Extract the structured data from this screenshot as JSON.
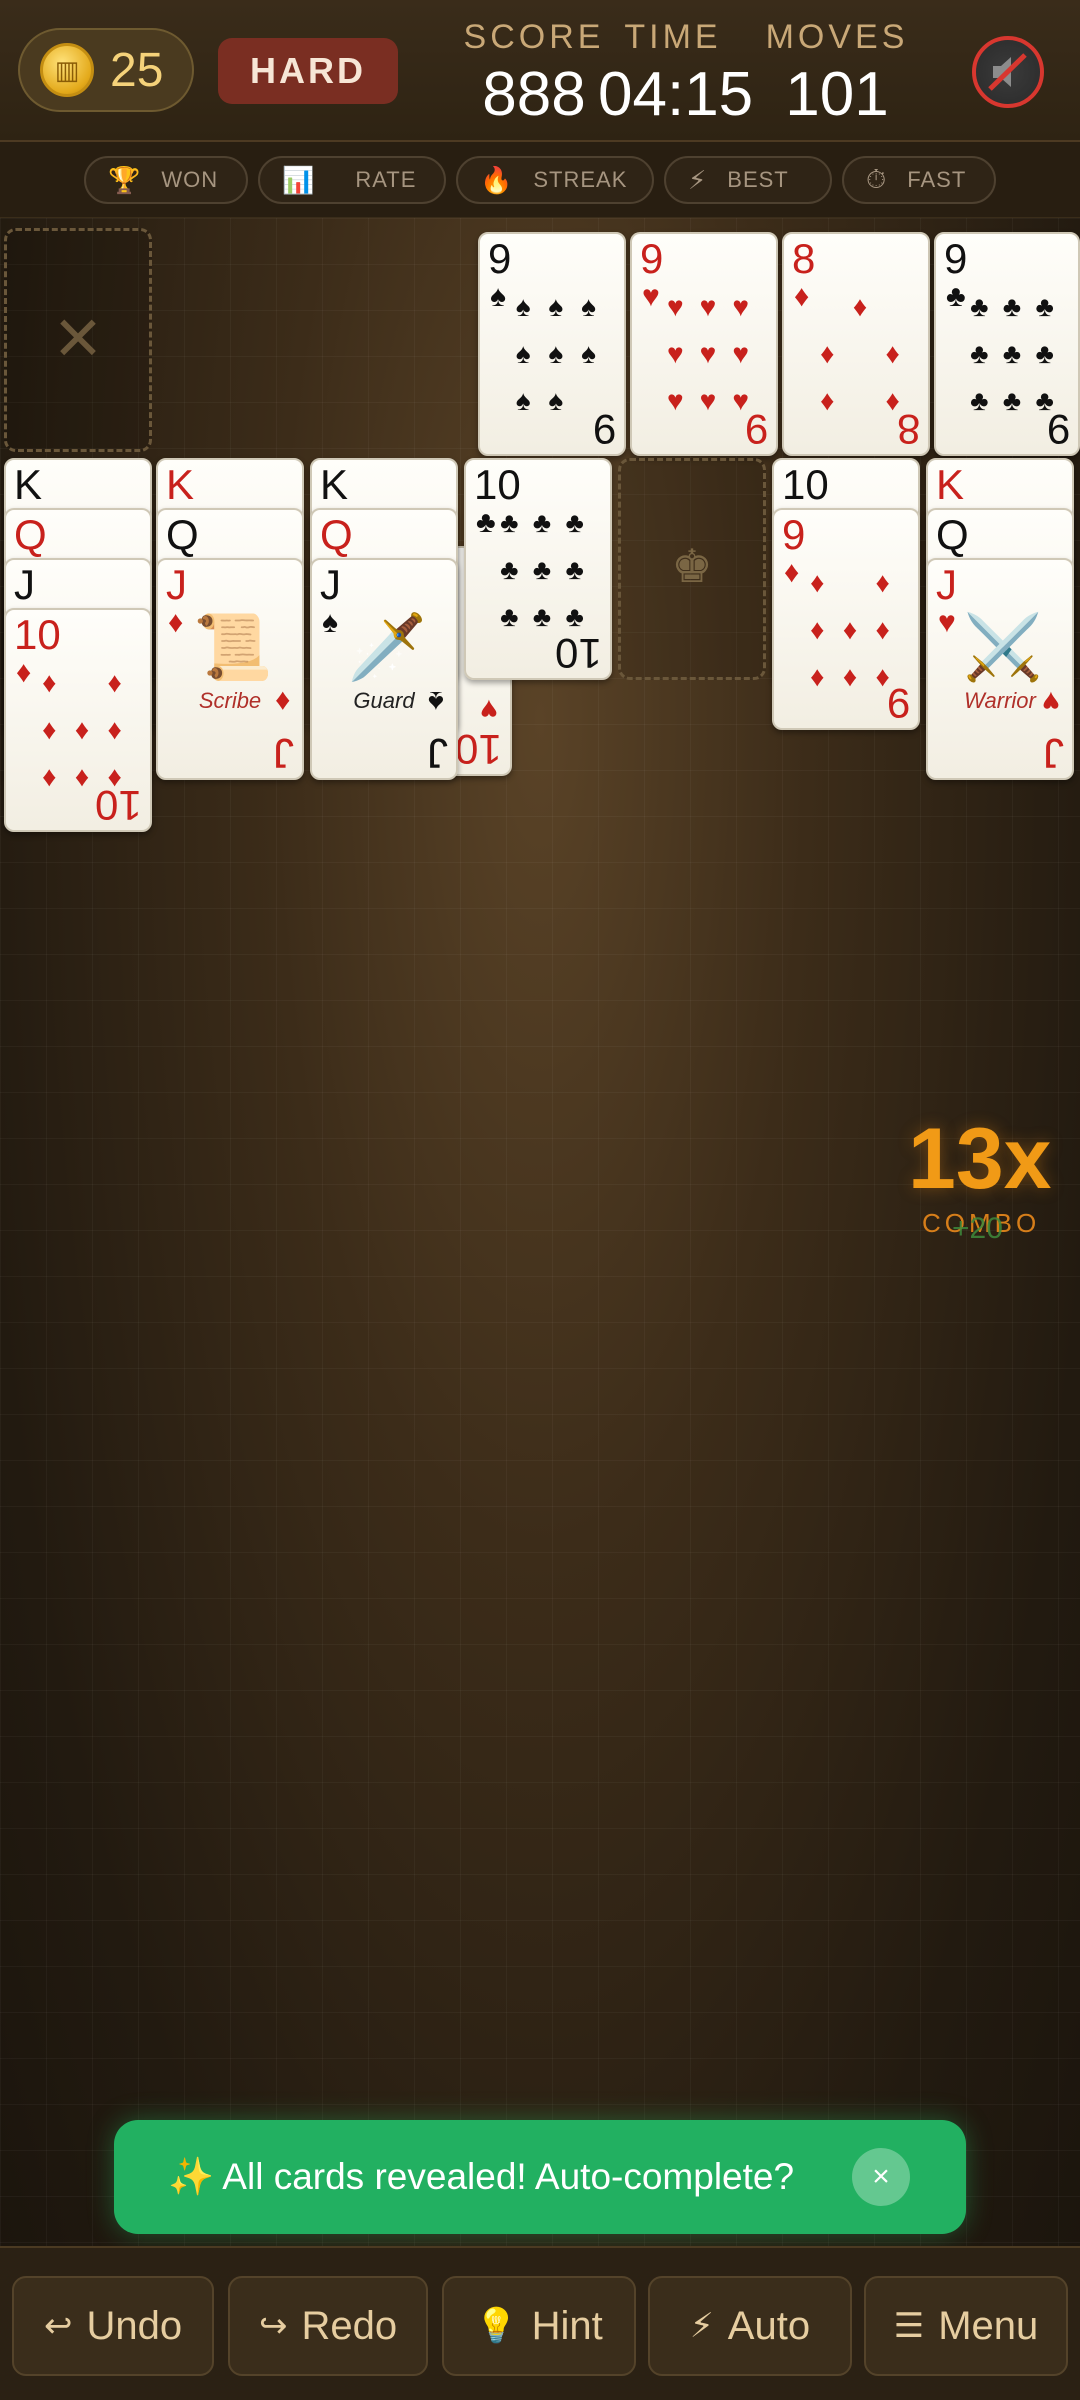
{
  "header": {
    "coins": "25",
    "difficulty": "HARD",
    "score_label": "SCORE",
    "score": "888",
    "time_label": "TIME",
    "time": "04:15",
    "moves_label": "MOVES",
    "moves": "101",
    "sound_icon": "mute-icon"
  },
  "stats_strip": [
    {
      "icon": "🏆",
      "label": "WON"
    },
    {
      "icon": "📊",
      "label": "RATE"
    },
    {
      "icon": "🔥",
      "label": "STREAK"
    },
    {
      "icon": "⚡",
      "label": "BEST"
    },
    {
      "icon": "⏱",
      "label": "FAST"
    }
  ],
  "foundations": [
    {
      "rank": "9",
      "suit": "♠",
      "color": "black"
    },
    {
      "rank": "9",
      "suit": "♥",
      "color": "red"
    },
    {
      "rank": "8",
      "suit": "♦",
      "color": "red"
    },
    {
      "rank": "9",
      "suit": "♣",
      "color": "black"
    }
  ],
  "stock_empty_icon": "×",
  "tableau": {
    "col1": {
      "K": "K",
      "Q": "Q",
      "J": "J",
      "top_rank": "10",
      "top_suit": "♦"
    },
    "col2": {
      "K": "K",
      "Q": "Q",
      "J": "J",
      "J_suit": "♦",
      "face_label": "Scribe",
      "face_icon": "📜"
    },
    "col3": {
      "K": "K",
      "Q": "Q",
      "J": "J",
      "J_suit": "♠",
      "face_label": "Guard",
      "face_icon": "🗡️",
      "under_rank": "10",
      "under_suit": "♥"
    },
    "col4": {
      "top_rank": "10",
      "top_suit": "♣"
    },
    "col5": {
      "empty_icon": "♚"
    },
    "col6": {
      "under_rank": "10",
      "top_rank": "9",
      "top_suit": "♦"
    },
    "col7": {
      "K": "K",
      "Q": "Q",
      "J": "J",
      "J_suit": "♥",
      "face_label": "Warrior",
      "face_icon": "⚔️"
    }
  },
  "combo": {
    "value": "13x",
    "label": "COMBO",
    "bonus": "+20"
  },
  "toast": {
    "text": "✨ All cards revealed! Auto-complete?",
    "close": "×"
  },
  "bottom": {
    "undo": {
      "icon": "↩",
      "label": "Undo"
    },
    "redo": {
      "icon": "↪",
      "label": "Redo"
    },
    "hint": {
      "icon": "💡",
      "label": "Hint"
    },
    "auto": {
      "icon": "⚡",
      "label": "Auto"
    },
    "menu": {
      "icon": "☰",
      "label": "Menu"
    }
  }
}
